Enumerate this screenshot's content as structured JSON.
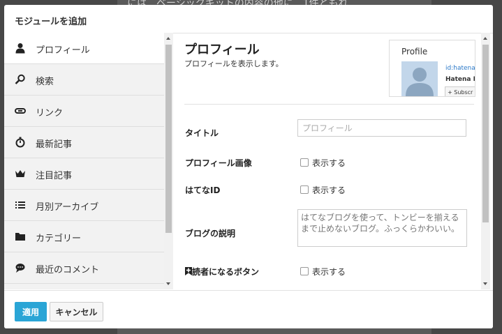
{
  "background": {
    "partial_text": "には　ベーシックキットの内容の他に　1件ともれ"
  },
  "dialog": {
    "title": "モジュールを追加"
  },
  "sidebar": {
    "items": [
      {
        "label": "プロフィール",
        "icon": "person-icon",
        "active": true
      },
      {
        "label": "検索",
        "icon": "search-icon",
        "active": false
      },
      {
        "label": "リンク",
        "icon": "link-icon",
        "active": false
      },
      {
        "label": "最新記事",
        "icon": "stopwatch-icon",
        "active": false
      },
      {
        "label": "注目記事",
        "icon": "crown-icon",
        "active": false
      },
      {
        "label": "月別アーカイブ",
        "icon": "list-icon",
        "active": false
      },
      {
        "label": "カテゴリー",
        "icon": "folder-icon",
        "active": false
      },
      {
        "label": "最近のコメント",
        "icon": "comment-icon",
        "active": false
      }
    ]
  },
  "content": {
    "title": "プロフィール",
    "subtitle": "プロフィールを表示します。",
    "preview": {
      "title": "Profile",
      "user_id": "id:hatena",
      "user_name": "Hatena B",
      "subscribe": "Subscr"
    },
    "fields": {
      "title_label": "タイトル",
      "title_placeholder": "プロフィール",
      "image_label": "プロフィール画像",
      "image_checkbox": "表示する",
      "hatena_id_label": "はてなID",
      "hatena_id_checkbox": "表示する",
      "description_label": "ブログの説明",
      "description_placeholder": "はてなブログを使って、トンビーを揃えるまで止めないブログ。ふっくらかわいい。",
      "reader_label": "読者になるボタン",
      "reader_checkbox": "表示する"
    }
  },
  "footer": {
    "apply": "適用",
    "cancel": "キャンセル"
  },
  "colors": {
    "accent": "#2aa5d6",
    "link": "#2a78c8"
  }
}
